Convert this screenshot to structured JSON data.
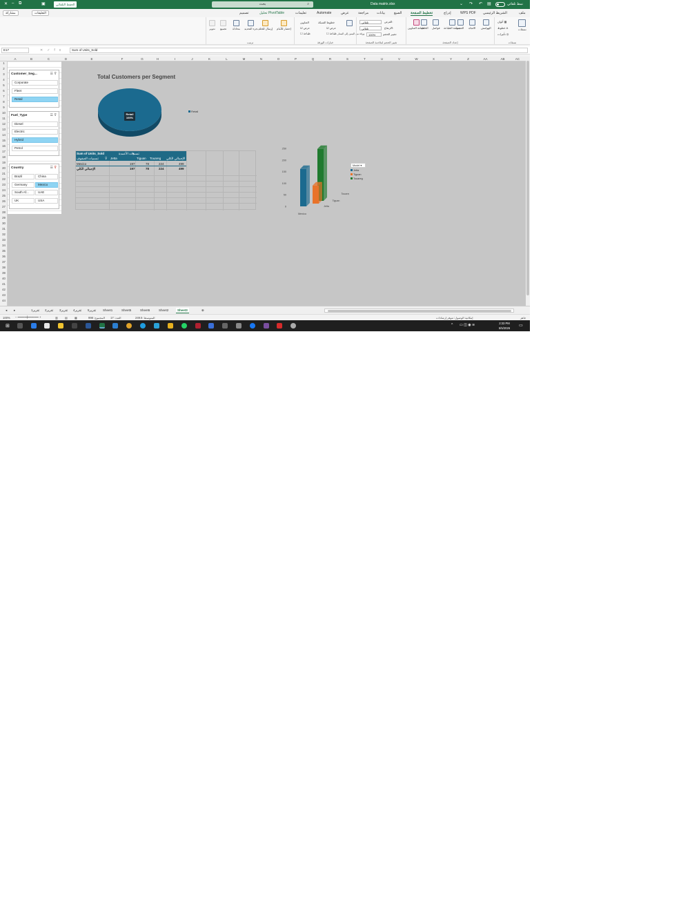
{
  "titlebar": {
    "autosave_label": "الحفظ التلقائي",
    "file_name": "Data matrix.xlsx",
    "search_placeholder": "بحث",
    "mode_label": "نمط تلقائي"
  },
  "ribbon_tabs": [
    {
      "label": "ملف"
    },
    {
      "label": "الشريط الرئيسي"
    },
    {
      "label": "WPS PDF"
    },
    {
      "label": "إدراج"
    },
    {
      "label": "تخطيط الصفحة"
    },
    {
      "label": "الصيغ"
    },
    {
      "label": "بيانات"
    },
    {
      "label": "مراجعة"
    },
    {
      "label": "عرض"
    },
    {
      "label": "Automate"
    },
    {
      "label": "تعليمات"
    },
    {
      "label": "تحليل PivotTable"
    },
    {
      "label": "تصميم"
    }
  ],
  "ribbon_buttons": {
    "comments": "التعليقات",
    "share": "مشاركة"
  },
  "ribbon": {
    "themes": {
      "label": "نسقات",
      "colors": "ألوان",
      "fonts": "خطوط",
      "effects": "تأثيرات",
      "group": "نسقات"
    },
    "page_setup": {
      "margins": "الهوامش",
      "orientation": "الاتجاه",
      "size": "الحجم",
      "print_area": "منطقة الطباعة",
      "breaks": "فواصل",
      "background": "الخلفية",
      "print_titles": "طباعة العناوين",
      "group": "إعداد الصفحة"
    },
    "scale": {
      "width_label": "العرض:",
      "width_value": "تلقائي",
      "height_label": "الارتفاع:",
      "height_value": "تلقائي",
      "scale_label": "تغيير الحجم:",
      "scale_value": "100%",
      "group": "تغيير الحجم لملاءمة الصفحة"
    },
    "sheet_options": {
      "gridlines": "خطوط الشبكة",
      "headings": "العناوين",
      "view": "عرض",
      "print": "طباعة",
      "rtl": "ورقة من اليمين إلى اليسار",
      "group": "خيارات الورقة"
    },
    "arrange": {
      "bring_forward": "إحضار للأمام",
      "send_backward": "إرسال للخلف",
      "selection_pane": "جزء التحديد",
      "align": "محاذاة",
      "group_btn": "تجميع",
      "rotate": "تدوير",
      "group": "ترتيب"
    }
  },
  "formula_bar": {
    "name_box": "E17",
    "fx": "fx",
    "formula": "Sum of Units_Sold"
  },
  "columns": [
    "A",
    "B",
    "C",
    "D",
    "E",
    "F",
    "G",
    "H",
    "I",
    "J",
    "K",
    "L",
    "M",
    "N",
    "O",
    "P",
    "Q",
    "R",
    "S",
    "T",
    "U",
    "V",
    "W",
    "X",
    "Y",
    "Z",
    "AA",
    "AB",
    "AC"
  ],
  "rows": [
    "1",
    "2",
    "3",
    "4",
    "5",
    "6",
    "7",
    "8",
    "9",
    "10",
    "11",
    "12",
    "13",
    "14",
    "15",
    "16",
    "17",
    "18",
    "19",
    "20",
    "21",
    "22",
    "23",
    "24",
    "25",
    "26",
    "27",
    "28",
    "29",
    "30",
    "31",
    "32",
    "33",
    "34",
    "35",
    "36",
    "37",
    "38",
    "39",
    "40",
    "41",
    "42",
    "43",
    "44"
  ],
  "slicers": {
    "segment": {
      "title": "Customer_Seg...",
      "items": [
        {
          "label": "Corporate",
          "selected": false
        },
        {
          "label": "Fleet",
          "selected": false
        },
        {
          "label": "Retail",
          "selected": true
        }
      ]
    },
    "fuel": {
      "title": "Fuel_Type",
      "items": [
        {
          "label": "Diesel",
          "selected": false
        },
        {
          "label": "Electric",
          "selected": false
        },
        {
          "label": "Hybrid",
          "selected": true
        },
        {
          "label": "Petrol",
          "selected": false
        }
      ]
    },
    "country": {
      "title": "Country",
      "items": [
        {
          "label": "Brazil",
          "selected": false
        },
        {
          "label": "China",
          "selected": false
        },
        {
          "label": "Germany",
          "selected": false
        },
        {
          "label": "Mexico",
          "selected": true
        },
        {
          "label": "South Af...",
          "selected": false
        },
        {
          "label": "UAE",
          "selected": false
        },
        {
          "label": "UK",
          "selected": false
        },
        {
          "label": "USA",
          "selected": false
        }
      ]
    }
  },
  "pivot": {
    "value_field": "Sum of Units_Sold",
    "col_label": "تسميات الأعمدة",
    "row_label": "تسميات الصفوف",
    "headers": [
      "Jetta",
      "Tiguan",
      "Touareg",
      "الإجمالي الكلي"
    ],
    "rows": [
      {
        "label": "Mexico",
        "values": [
          "197",
          "78",
          "224",
          "499"
        ]
      },
      {
        "label": "الإجمالي الكلي",
        "values": [
          "197",
          "78",
          "224",
          "499"
        ]
      }
    ]
  },
  "chart_data": [
    {
      "type": "pie",
      "title": "Total Customers per Segment",
      "categories": [
        "Retail"
      ],
      "values": [
        100
      ],
      "data_labels": [
        "Retail",
        "100%"
      ],
      "legend": [
        "Retail"
      ],
      "legend_position": "right",
      "colors": [
        "#1b6a8f"
      ]
    },
    {
      "type": "bar",
      "title": "",
      "categories": [
        "Mexico"
      ],
      "series": [
        {
          "name": "Jetta",
          "values": [
            197
          ]
        },
        {
          "name": "Tiguan",
          "values": [
            78
          ]
        },
        {
          "name": "Touareg",
          "values": [
            224
          ]
        }
      ],
      "ylim": [
        0,
        250
      ],
      "yticks": [
        "0",
        "50",
        "100",
        "150",
        "200",
        "250"
      ],
      "legend_title": "Model",
      "legend_position": "right",
      "grid": false,
      "colors": [
        "#1b6a8f",
        "#e8732a",
        "#1f7a2e"
      ]
    }
  ],
  "sheet_tabs": [
    {
      "label": "تقرير1",
      "active": false
    },
    {
      "label": "تقرير2",
      "active": false
    },
    {
      "label": "تقرير3",
      "active": false
    },
    {
      "label": "تقرير4",
      "active": false
    },
    {
      "label": "تقرير5",
      "active": false
    },
    {
      "label": "تقرير6",
      "active": false
    },
    {
      "label": "Sheet1",
      "active": false
    },
    {
      "label": "Sheet5",
      "active": false
    },
    {
      "label": "Sheet6",
      "active": false
    },
    {
      "label": "Sheet2",
      "active": false
    },
    {
      "label": "Sheet3",
      "active": true
    }
  ],
  "status": {
    "ready": "جاهز",
    "accessibility": "إمكانية الوصول: تتوفر إرشادات",
    "average": "المتوسط: 249.5",
    "count": "العدد: 17",
    "sum": "المجموع: 998",
    "zoom": "100%"
  },
  "taskbar": {
    "time": "2:33 PM",
    "date": "5/5/2026"
  },
  "colors": {
    "excel_green": "#217346",
    "pivot_header": "#1f6a86",
    "slicer_selected": "#8fd4f3"
  }
}
